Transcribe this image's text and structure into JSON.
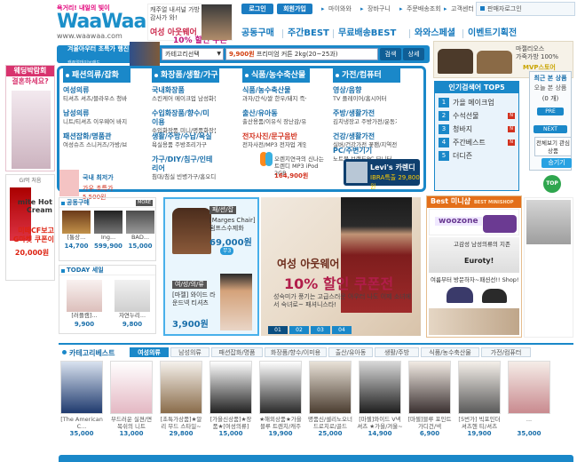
{
  "header": {
    "slogan": "욕거리! 내일의 빛이",
    "brand": "WaaWaa",
    "url": "www.waawaa.com",
    "top_banner": {
      "line1": "캐주얼 내셔널 가방 감사가 와!",
      "line2": "여성 아웃웨어",
      "line3": "10% 할인 쿠폰전"
    },
    "login_btn": "로그인",
    "join_btn": "회원가입",
    "links": [
      "마이와와",
      "장바구니",
      "주문배송조회",
      "고객센터"
    ],
    "visitor": "판매자로그인",
    "main_menu": [
      "공동구매",
      "주간BEST",
      "무료배송BEST",
      "와와스페셜",
      "이벤트기획전"
    ]
  },
  "search": {
    "category_placeholder": "카테고리선택",
    "price_highlight": "9,900원",
    "keyword": "프리미엄 커튼 2kg(20~25과)",
    "search_btn": "검색",
    "detail_btn": "상세"
  },
  "outdoor_promo": {
    "title": "겨울아우터 초특가 행진",
    "sub": "캐주얼데이브랜드"
  },
  "bag_promo": {
    "line1": "마젤리오스",
    "line2": "가죽가방 100%",
    "line3": "MVP스토어"
  },
  "wedding": {
    "title": "웨딩박람회",
    "subtitle": "결혼하세요?"
  },
  "noodle": {
    "header": "GI먹 처음",
    "brand": "mite Hot Cream",
    "line1": "미떼CF보고",
    "line2": "G마켓 쿠폰이",
    "line3": "20,000원"
  },
  "categories": [
    {
      "head": "패션의류/잡화",
      "groups": [
        {
          "title": "여성의류",
          "sub": "티셔츠 셔츠/블라우스 청바지/하의"
        },
        {
          "title": "남성의류",
          "sub": "니트/티셔츠 이우웨어 바지/JEAN"
        },
        {
          "title": "패션잡화/명품관",
          "sub": "여성슈즈 스니커즈/가방/브랜"
        }
      ]
    },
    {
      "head": "화장품/생활/가구",
      "groups": [
        {
          "title": "국내화장품",
          "sub": "스킨케어 메이크업 남성화장품"
        },
        {
          "title": "수입화장품/향수/미이용",
          "sub": "수입화장품 미니/명품화장품"
        },
        {
          "title": "생활/주방/수납/욕실",
          "sub": "욕실용품 주방조리가구"
        },
        {
          "title": "가구/DIY/침구/인테리어",
          "sub": "침대/침실 빈병가구/홈오디스"
        }
      ]
    },
    {
      "head": "식품/농수축산물",
      "groups": [
        {
          "title": "식품/농수축산물",
          "sub": "과자/간식/쌀 한우/돼지 즉석식품"
        },
        {
          "title": "출산/유아동",
          "sub": "출산용품/이유식 장난감/유아동의류"
        },
        {
          "title": "전자사진/문구음반",
          "sub": "전자사전/MP3 전자업 게임기/문구"
        }
      ]
    },
    {
      "head": "가전/컴퓨터",
      "groups": [
        {
          "title": "영상/음향",
          "sub": "TV 플레이어/홈시어터"
        },
        {
          "title": "주방/생활가전",
          "sub": "김치냉장고 주방가전/운동가전"
        },
        {
          "title": "건강/생활가전",
          "sub": "실버/건강가전 꽃팬/지역전가전"
        },
        {
          "title": "PC/주변기기",
          "sub": "노트북 브랜드PC 모니터"
        }
      ]
    }
  ],
  "cat_promos": {
    "small": {
      "name": "국내 최저가",
      "price": "가우 초특가 5,500원"
    },
    "trend": {
      "name": "오렌지연극의 신나는 트렌디 MP3 iPod 2GB",
      "price": "164,900원"
    },
    "levis": {
      "name": "Levi's 카렌디",
      "price": "IBRA특출 29,800원"
    }
  },
  "popular_search": {
    "title": "인기검색어 TOP5",
    "items": [
      {
        "rank": "1",
        "word": "가을 메이크업",
        "new": false
      },
      {
        "rank": "2",
        "word": "수석선물",
        "new": true
      },
      {
        "rank": "3",
        "word": "청바지",
        "new": true
      },
      {
        "rank": "4",
        "word": "주간베스트",
        "new": true
      },
      {
        "rank": "5",
        "word": "더디즌",
        "new": false
      }
    ]
  },
  "recent": {
    "title": "최근 본 상품",
    "sub": "오늘 본 상품",
    "count": "(0 개)",
    "pre": "PRE",
    "next": "NEXT"
  },
  "view_all": "전체보기 관심상품",
  "go_up": "승기기",
  "top_btn": "TOP",
  "group_buy": {
    "title": "공동구매",
    "more": "MORE",
    "items": [
      {
        "name": "[통상...",
        "price": "14,700"
      },
      {
        "name": "Ing...",
        "price": "599,900"
      },
      {
        "name": "BAD...",
        "price": "15,000"
      }
    ]
  },
  "today_sale": {
    "title": "TODAY 세일",
    "items": [
      {
        "name": "[러플캠]...",
        "price": "9,900"
      },
      {
        "name": "자연누리...",
        "price": "9,800"
      }
    ]
  },
  "featured": {
    "tag1": "패/션/잡",
    "name1": "[Marges Chair] 펌프스수제화",
    "price1": "69,000원",
    "no1": "무3",
    "tag2": "여/성/의/류",
    "name2": "[마젤] 와이드 라운드넥 티셔츠",
    "price2": "3,900원"
  },
  "big_banner": {
    "line1": "여성 아웃웨어",
    "line2": "10% 할인 쿠폰전",
    "line3": "성숙미가 풍기는 고급스러운 아우터 나도 이제 소녀에서 숙녀로~ 패셔니스타!",
    "pages": [
      "01",
      "02",
      "03",
      "04"
    ]
  },
  "best_mini": {
    "title": "Best 미니샵",
    "sub": "BEST MINISHOP",
    "m1": "woozone",
    "m2": "고감성 남성의류의 지존",
    "m2b": "Euroty!",
    "m3": "여름부터 방문하자~패션선!! Shop!"
  },
  "category_best": {
    "title": "카테고리베스트",
    "tabs": [
      "여성의류",
      "남성의류",
      "패션잡화/명품",
      "화장품/향수/이미용",
      "출산/유아동",
      "생활/주방",
      "식품/농수축산물",
      "가전/컴퓨터"
    ],
    "items": [
      {
        "name": "[The American C...",
        "price": "35,000"
      },
      {
        "name": "부드러운 실젼/면 목쉬의 니트",
        "price": "13,000"
      },
      {
        "name": "[초특가상품]★알리 무드 스타일~",
        "price": "29,800"
      },
      {
        "name": "[가을신상품]★장품★[여성의류]",
        "price": "15,000"
      },
      {
        "name": "★해외상품★가을 블루 트렌치/캐주얼",
        "price": "19,900"
      },
      {
        "name": "명품신/셀리노오너 드로치로/골드",
        "price": "25,000"
      },
      {
        "name": "[마젤]와이드 V넥 셔츠 ★가을/겨울~",
        "price": "14,900"
      },
      {
        "name": "[마젤]블루 포인트 가디건/넥",
        "price": "6,900"
      },
      {
        "name": "[5번가] 빅포인더 셔츠헨 티/셔츠",
        "price": "19,900"
      },
      {
        "name": "...",
        "price": "35,000"
      }
    ]
  }
}
